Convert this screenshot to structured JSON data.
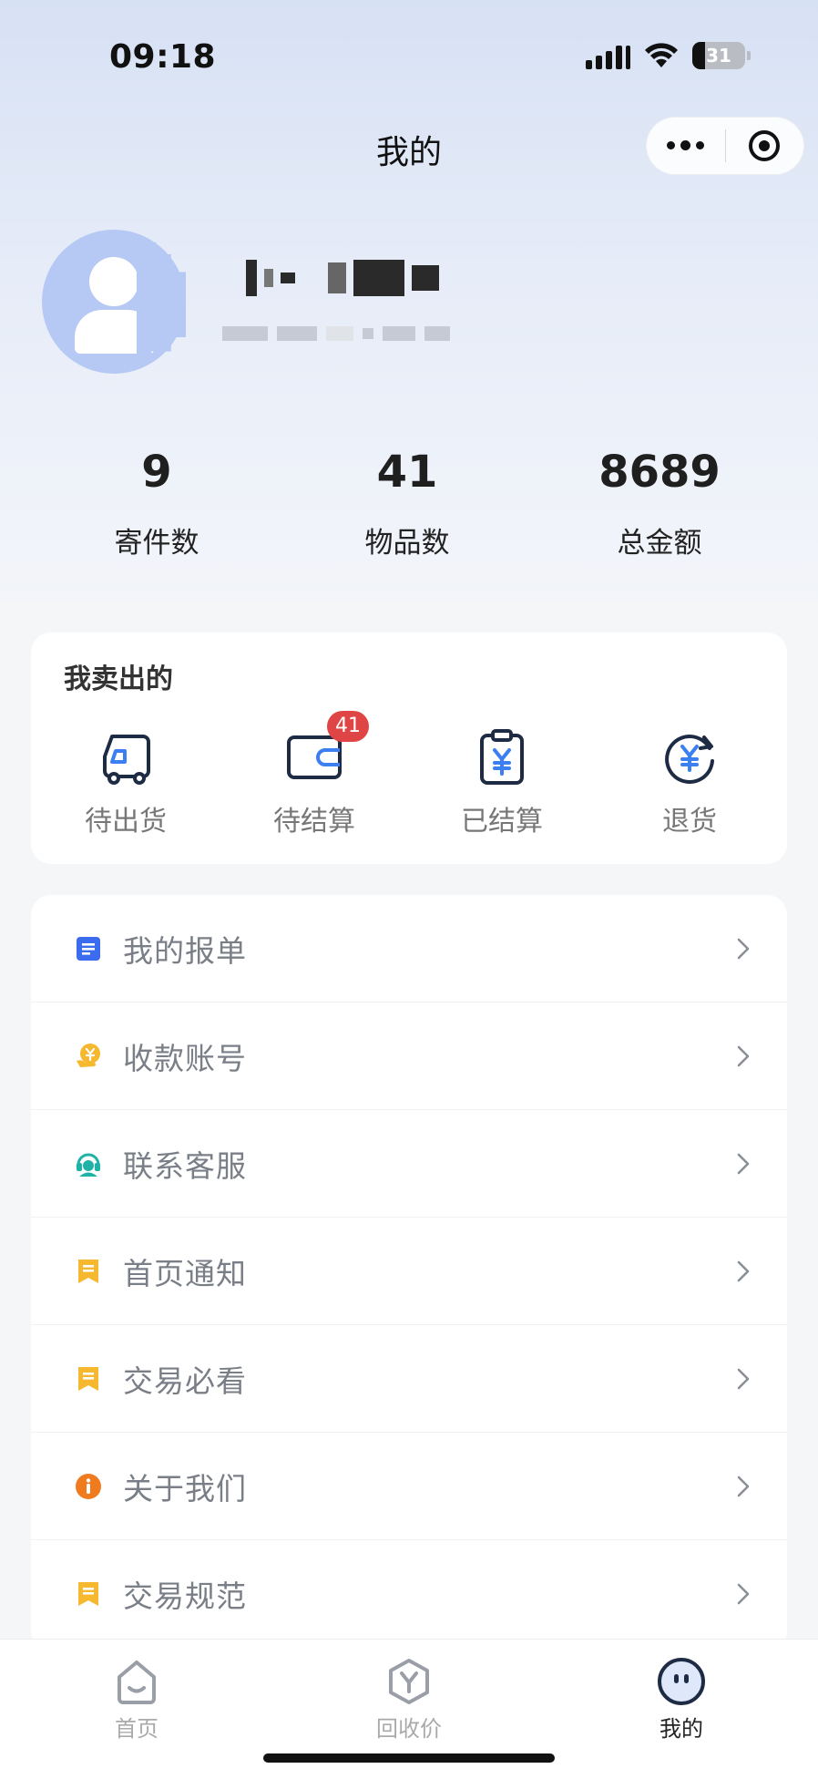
{
  "status_bar": {
    "time": "09:18",
    "battery": "31"
  },
  "nav": {
    "title": "我的"
  },
  "stats": [
    {
      "value": "9",
      "label": "寄件数"
    },
    {
      "value": "41",
      "label": "物品数"
    },
    {
      "value": "8689",
      "label": "总金额"
    }
  ],
  "sold": {
    "title": "我卖出的",
    "items": [
      {
        "label": "待出货",
        "icon": "truck-icon"
      },
      {
        "label": "待结算",
        "icon": "wallet-icon",
        "badge": "41"
      },
      {
        "label": "已结算",
        "icon": "clipboard-yen-icon"
      },
      {
        "label": "退货",
        "icon": "refund-yen-icon"
      }
    ]
  },
  "menu": [
    {
      "label": "我的报单",
      "icon": "document-icon",
      "color": "#3b6cf0"
    },
    {
      "label": "收款账号",
      "icon": "yen-hand-icon",
      "color": "#f5b82e"
    },
    {
      "label": "联系客服",
      "icon": "headset-icon",
      "color": "#1fb3a8"
    },
    {
      "label": "首页通知",
      "icon": "notice-icon",
      "color": "#f5b82e"
    },
    {
      "label": "交易必看",
      "icon": "notice-icon",
      "color": "#f5b82e"
    },
    {
      "label": "关于我们",
      "icon": "info-icon",
      "color": "#f07a1e"
    },
    {
      "label": "交易规范",
      "icon": "notice-icon",
      "color": "#f5b82e"
    }
  ],
  "tabbar": [
    {
      "label": "首页",
      "icon": "home-icon"
    },
    {
      "label": "回收价",
      "icon": "recycle-price-icon"
    },
    {
      "label": "我的",
      "icon": "profile-icon",
      "active": true
    }
  ]
}
